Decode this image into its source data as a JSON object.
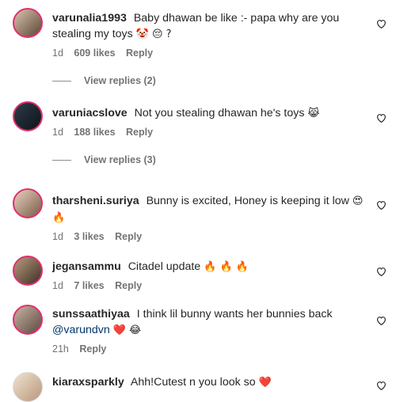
{
  "comments": [
    {
      "username": "varunalia1993",
      "text": "Baby dhawan be like :- papa why are you stealing my toys",
      "emojis": "🤡 😔 ?",
      "time": "1d",
      "likes": "609 likes",
      "reply": "Reply",
      "view_replies": "View replies (2)"
    },
    {
      "username": "varuniacslove",
      "text": "Not you stealing dhawan he's toys",
      "emojis": "😹",
      "time": "1d",
      "likes": "188 likes",
      "reply": "Reply",
      "view_replies": "View replies (3)"
    },
    {
      "username": "tharsheni.suriya",
      "text": "Bunny is excited, Honey is keeping it low",
      "emojis": "😍 🔥",
      "time": "1d",
      "likes": "3 likes",
      "reply": "Reply"
    },
    {
      "username": "jegansammu",
      "text": "Citadel update",
      "emojis": "🔥 🔥 🔥",
      "time": "1d",
      "likes": "7 likes",
      "reply": "Reply"
    },
    {
      "username": "sunssaathiyaa",
      "text": "I think lil bunny wants her bunnies back",
      "mention": "@varundvn",
      "emojis": "❤️ 😂",
      "time": "21h",
      "reply": "Reply"
    },
    {
      "username": "kiaraxsparkly",
      "text": "Ahh!Cutest n you look so",
      "emojis": "❤️"
    }
  ],
  "icons": {
    "like": "heart-outline-icon"
  },
  "colors": {
    "meta": "#737373",
    "mention": "#00376b",
    "heart": "#ed4956"
  }
}
